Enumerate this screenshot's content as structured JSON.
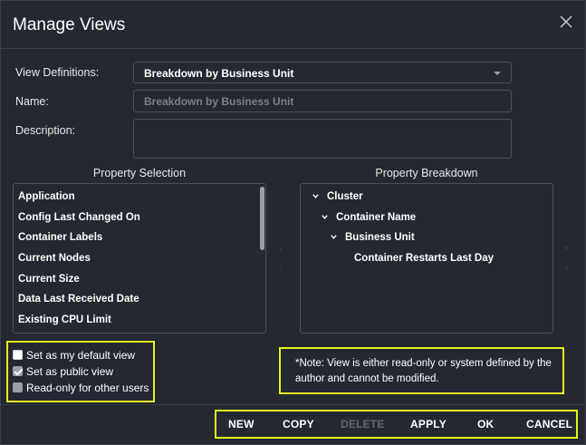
{
  "dialog": {
    "title": "Manage Views"
  },
  "form": {
    "view_definitions_label": "View Definitions:",
    "view_definitions_value": "Breakdown by Business Unit",
    "name_label": "Name:",
    "name_placeholder": "Breakdown by Business Unit",
    "description_label": "Description:"
  },
  "property_selection": {
    "title": "Property Selection",
    "items": [
      "Application",
      "Config Last Changed On",
      "Container Labels",
      "Current Nodes",
      "Current Size",
      "Data Last Received Date",
      "Existing CPU Limit"
    ]
  },
  "property_breakdown": {
    "title": "Property Breakdown",
    "items": [
      "Cluster",
      "Container Name",
      "Business Unit",
      "Container Restarts Last Day"
    ]
  },
  "options": {
    "default_view": "Set as my default view",
    "public_view": "Set as public view",
    "read_only": "Read-only for other users"
  },
  "note": "*Note: View is either read-only or system defined by the author and cannot be modified.",
  "footer": {
    "new": "NEW",
    "copy": "COPY",
    "delete": "DELETE",
    "apply": "APPLY",
    "ok": "OK",
    "cancel": "CANCEL"
  },
  "colors": {
    "background": "#242831",
    "highlight": "#e4f51f",
    "disabled_text": "#5f6570"
  },
  "icons": {
    "close": "close-icon",
    "dropdown": "caret-down-icon",
    "tree_expand": "chevron-down-icon"
  }
}
